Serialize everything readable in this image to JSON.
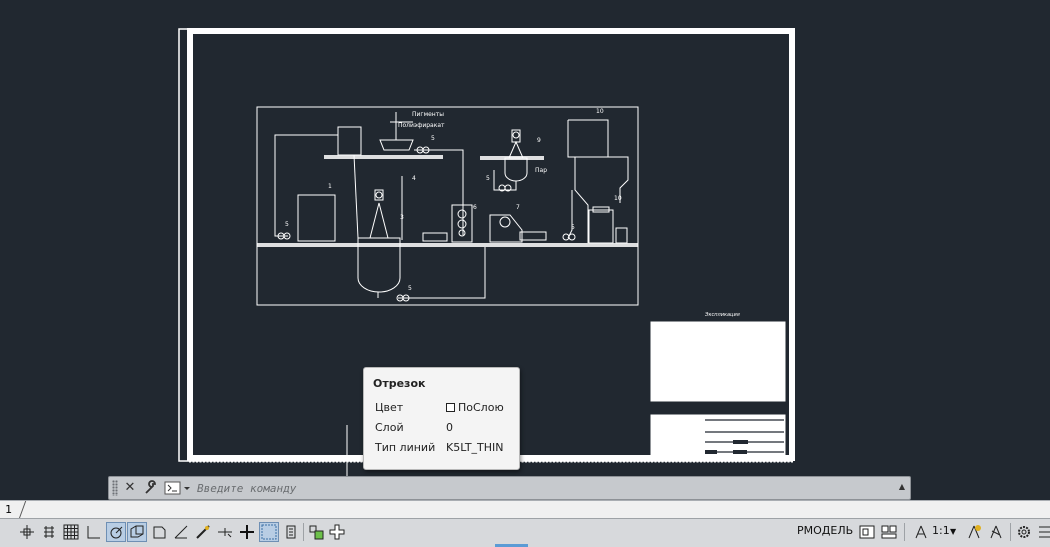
{
  "drawing": {
    "header_labels": [
      "Пигменты",
      "Полиэфиракат"
    ],
    "callouts": [
      "1",
      "2",
      "3",
      "4",
      "5",
      "6",
      "7",
      "8",
      "9",
      "10"
    ],
    "steam_label": "Пар",
    "stamp_caption": "Экспликация",
    "colors": {
      "background": "#212830",
      "lines": "#ffffff"
    }
  },
  "tooltip": {
    "title": "Отрезок",
    "rows": [
      {
        "key": "Цвет",
        "value": "ПоСлою",
        "swatch": true
      },
      {
        "key": "Слой",
        "value": "0"
      },
      {
        "key": "Тип линий",
        "value": "K5LT_THIN"
      }
    ]
  },
  "command_line": {
    "placeholder": "Введите команду",
    "close_icon": "close-icon",
    "settings_icon": "wrench-icon",
    "prompt_icon": "command-prompt-icon"
  },
  "layout_tabs": {
    "current": "1"
  },
  "status_bar": {
    "model_label": "РМОДЕЛЬ",
    "scale_label": "1:1",
    "accent": "#6e8fb4"
  }
}
